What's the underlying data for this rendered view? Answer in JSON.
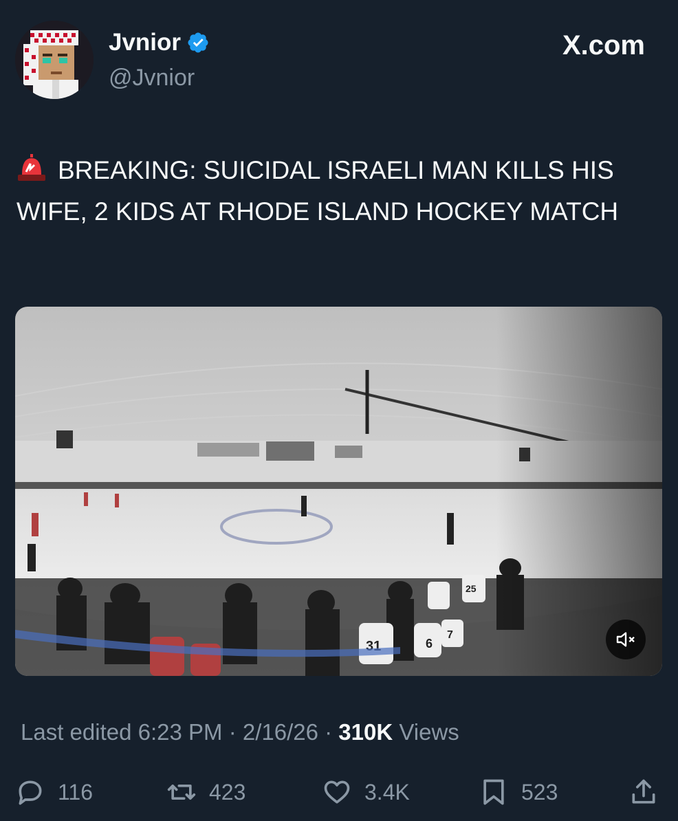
{
  "author": {
    "display_name": "Jvnior",
    "handle": "@Jvnior",
    "verified": true,
    "avatar_icon": "pixel-avatar-icon"
  },
  "site": {
    "label": "X.com"
  },
  "tweet": {
    "text": "BREAKING: SUICIDAL ISRAELI MAN KILLS HIS WIFE, 2 KIDS AT RHODE ISLAND HOCKEY MATCH",
    "emoji_icon": "siren-icon"
  },
  "media": {
    "type": "video",
    "description_icon": "video-thumbnail",
    "mute_icon": "speaker-muted-icon",
    "jersey_numbers": [
      "31",
      "6",
      "7",
      "25"
    ]
  },
  "meta": {
    "edited_label": "Last edited 6:23 PM · 2/16/26 · ",
    "views_count": "310K",
    "views_label": " Views"
  },
  "actions": {
    "replies": "116",
    "reposts": "423",
    "likes": "3.4K",
    "bookmarks": "523"
  },
  "colors": {
    "background": "#16202c",
    "primary_text": "#f7f9f9",
    "secondary_text": "#8b98a5",
    "verified_blue": "#1d9bf0"
  }
}
